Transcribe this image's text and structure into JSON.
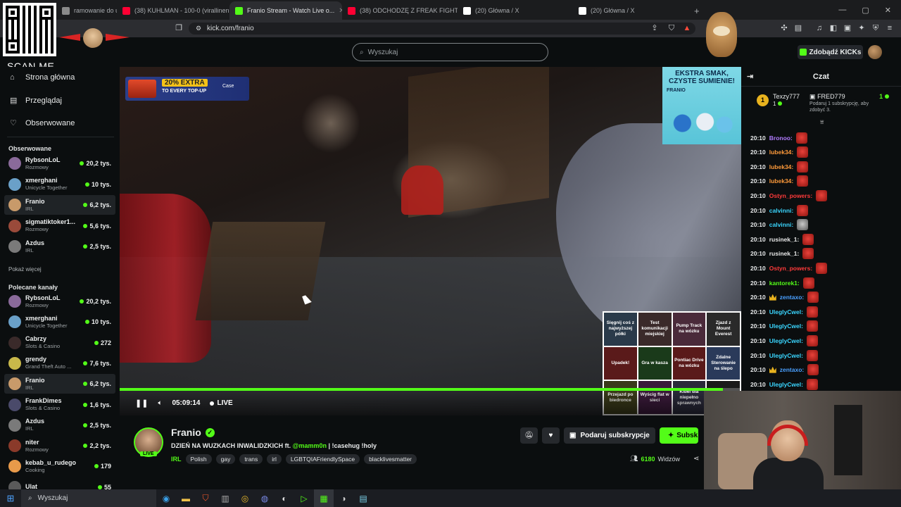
{
  "browser": {
    "tabs": [
      {
        "title": "ramowanie do ulep...",
        "fav_color": "#8a8a8a"
      },
      {
        "title": "(38) KUHLMAN - 100-0 (virallinen m...",
        "fav_color": "#ff0033"
      },
      {
        "title": "Franio Stream - Watch Live o...",
        "fav_color": "#53fc18",
        "active": true
      },
      {
        "title": "(38) ODCHODZĘ Z FREAK FIGHTÓW |",
        "fav_color": "#ff0033"
      },
      {
        "title": "(20) Główna / X",
        "fav_color": "#ffffff"
      },
      {
        "title": "(20) Główna / X",
        "fav_color": "#ffffff"
      }
    ],
    "url": "kick.com/franio",
    "new_tab": "+",
    "min": "—",
    "max": "▢",
    "close": "✕"
  },
  "overlay": {
    "scan_me": "SCAN ME"
  },
  "header": {
    "search_placeholder": "Wyszukaj",
    "get_kicks": "Zdobądź KICKs"
  },
  "sidebar": {
    "nav": [
      {
        "label": "Strona główna",
        "icon": "home-icon"
      },
      {
        "label": "Przeglądaj",
        "icon": "browse-icon"
      },
      {
        "label": "Obserwowane",
        "icon": "heart-icon"
      }
    ],
    "following_title": "Obserwowane",
    "following": [
      {
        "name": "RybsonLoL",
        "category": "Rozmowy",
        "viewers": "20,2 tys.",
        "color": "#8a6a9a"
      },
      {
        "name": "xmerghani",
        "category": "Unicycle Together",
        "viewers": "10 tys.",
        "color": "#6aa0c8"
      },
      {
        "name": "Franio",
        "category": "IRL",
        "viewers": "6,2 tys.",
        "color": "#c89a6a",
        "selected": true
      },
      {
        "name": "sigmatiktoker1...",
        "category": "Rozmowy",
        "viewers": "5,6 tys.",
        "color": "#9a4a3a"
      },
      {
        "name": "Azdus",
        "category": "IRL",
        "viewers": "2,5 tys.",
        "color": "#7a7a7a"
      }
    ],
    "show_more": "Pokaż więcej",
    "recommended_title": "Polecane kanały",
    "recommended": [
      {
        "name": "RybsonLoL",
        "category": "Rozmowy",
        "viewers": "20,2 tys.",
        "color": "#8a6a9a"
      },
      {
        "name": "xmerghani",
        "category": "Unicycle Together",
        "viewers": "10 tys.",
        "color": "#6aa0c8"
      },
      {
        "name": "Cabrzy",
        "category": "Slots & Casino",
        "viewers": "272",
        "color": "#3a2a2a"
      },
      {
        "name": "grendy",
        "category": "Grand Theft Auto ...",
        "viewers": "7,6 tys.",
        "color": "#c8b84a"
      },
      {
        "name": "Franio",
        "category": "IRL",
        "viewers": "6,2 tys.",
        "color": "#c89a6a",
        "selected": true
      },
      {
        "name": "FrankDimes",
        "category": "Slots & Casino",
        "viewers": "1,6 tys.",
        "color": "#4a4a6a"
      },
      {
        "name": "Azdus",
        "category": "IRL",
        "viewers": "2,5 tys.",
        "color": "#7a7a7a"
      },
      {
        "name": "niter",
        "category": "Rozmowy",
        "viewers": "2,2 tys.",
        "color": "#8a3a2a"
      },
      {
        "name": "kebab_u_rudego",
        "category": "Cooking",
        "viewers": "179",
        "color": "#e89a4a"
      },
      {
        "name": "Ulat",
        "category": "",
        "viewers": "55",
        "color": "#5a5a5a"
      }
    ]
  },
  "video": {
    "promo_big": "20% EXTRA",
    "promo_small": "TO EVERY TOP-UP",
    "promo_brand": "Case",
    "ad_heading": "EKSTRA SMAK, CZYSTE SUMIENIE!",
    "ad_brand": "FRANIO",
    "grid": [
      "Sięgnij coś z najwyższej półki",
      "Test komunikacji miejskiej",
      "Pump Track na wózku",
      "Zjazd z Mount Everest",
      "Upadek!",
      "Gra w kasza",
      "Pontiac Drive na wózku",
      "Zdalne Sterowanie na ślepo",
      "Przejazd po biedronce",
      "Wyścig flat w sieci",
      "Kibel dla niepełno sprawnych",
      ""
    ],
    "time": "05:09:14",
    "live_label": "LIVE",
    "progress": 0.97
  },
  "stream": {
    "name": "Franio",
    "live_badge": "LIVE",
    "title_before": "DZIEŃ NA WUZKACH INWALIDZKICH ft.",
    "title_mention": "@mamm0n",
    "title_after": "| !casehug !holy",
    "category": "IRL",
    "tags": [
      "Polish",
      "gay",
      "trans",
      "irl",
      "LGBTQIAFriendlySpace",
      "blacklivesmatter"
    ],
    "gift_label": "Podaruj subskrypcje",
    "sub_label": "Subsk",
    "viewers": "6180",
    "viewers_label": "Widzów"
  },
  "chat": {
    "title": "Czat",
    "pinned": {
      "rank": "1",
      "user": "Texzy777",
      "user_count": "1",
      "gifter": "FRED779",
      "gifter_count": "1",
      "gift_hint": "Podaruj 1 subskrypcję, aby zdobyć 3."
    },
    "messages": [
      {
        "time": "20:10",
        "user": "Bronoo:",
        "color": "#b27cff",
        "emote": "red"
      },
      {
        "time": "20:10",
        "user": "lubek34:",
        "color": "#ff9a3a",
        "emote": "red"
      },
      {
        "time": "20:10",
        "user": "lubek34:",
        "color": "#ff9a3a",
        "emote": "red"
      },
      {
        "time": "20:10",
        "user": "lubek34:",
        "color": "#ff9a3a",
        "emote": "red"
      },
      {
        "time": "20:10",
        "user": "Ostyn_powers:",
        "color": "#ff3a3a",
        "emote": "red"
      },
      {
        "time": "20:10",
        "user": "calvinni:",
        "color": "#3ad6ff",
        "emote": "red"
      },
      {
        "time": "20:10",
        "user": "calvinni:",
        "color": "#3ad6ff",
        "emote": "gray"
      },
      {
        "time": "20:10",
        "user": "rusinek_1:",
        "color": "#e8e8e8",
        "emote": "red"
      },
      {
        "time": "20:10",
        "user": "rusinek_1:",
        "color": "#e8e8e8",
        "emote": "red"
      },
      {
        "time": "20:10",
        "user": "Ostyn_powers:",
        "color": "#ff3a3a",
        "emote": "red"
      },
      {
        "time": "20:10",
        "user": "kantorek1:",
        "color": "#53fc18",
        "emote": "red"
      },
      {
        "time": "20:10",
        "user": "zentaxo:",
        "color": "#4aa0ff",
        "emote": "red",
        "crown": true
      },
      {
        "time": "20:10",
        "user": "UleglyCwel:",
        "color": "#3ad6ff",
        "emote": "red"
      },
      {
        "time": "20:10",
        "user": "UleglyCwel:",
        "color": "#3ad6ff",
        "emote": "red"
      },
      {
        "time": "20:10",
        "user": "UleglyCwel:",
        "color": "#3ad6ff",
        "emote": "red"
      },
      {
        "time": "20:10",
        "user": "UleglyCwel:",
        "color": "#3ad6ff",
        "emote": "red"
      },
      {
        "time": "20:10",
        "user": "zentaxo:",
        "color": "#4aa0ff",
        "emote": "red",
        "crown": true
      },
      {
        "time": "20:10",
        "user": "UleglyCwel:",
        "color": "#3ad6ff",
        "emote": "red"
      }
    ]
  },
  "taskbar": {
    "search": "Wyszukaj"
  },
  "colors": {
    "accent": "#53fc18",
    "bg": "#0b0e0f"
  }
}
